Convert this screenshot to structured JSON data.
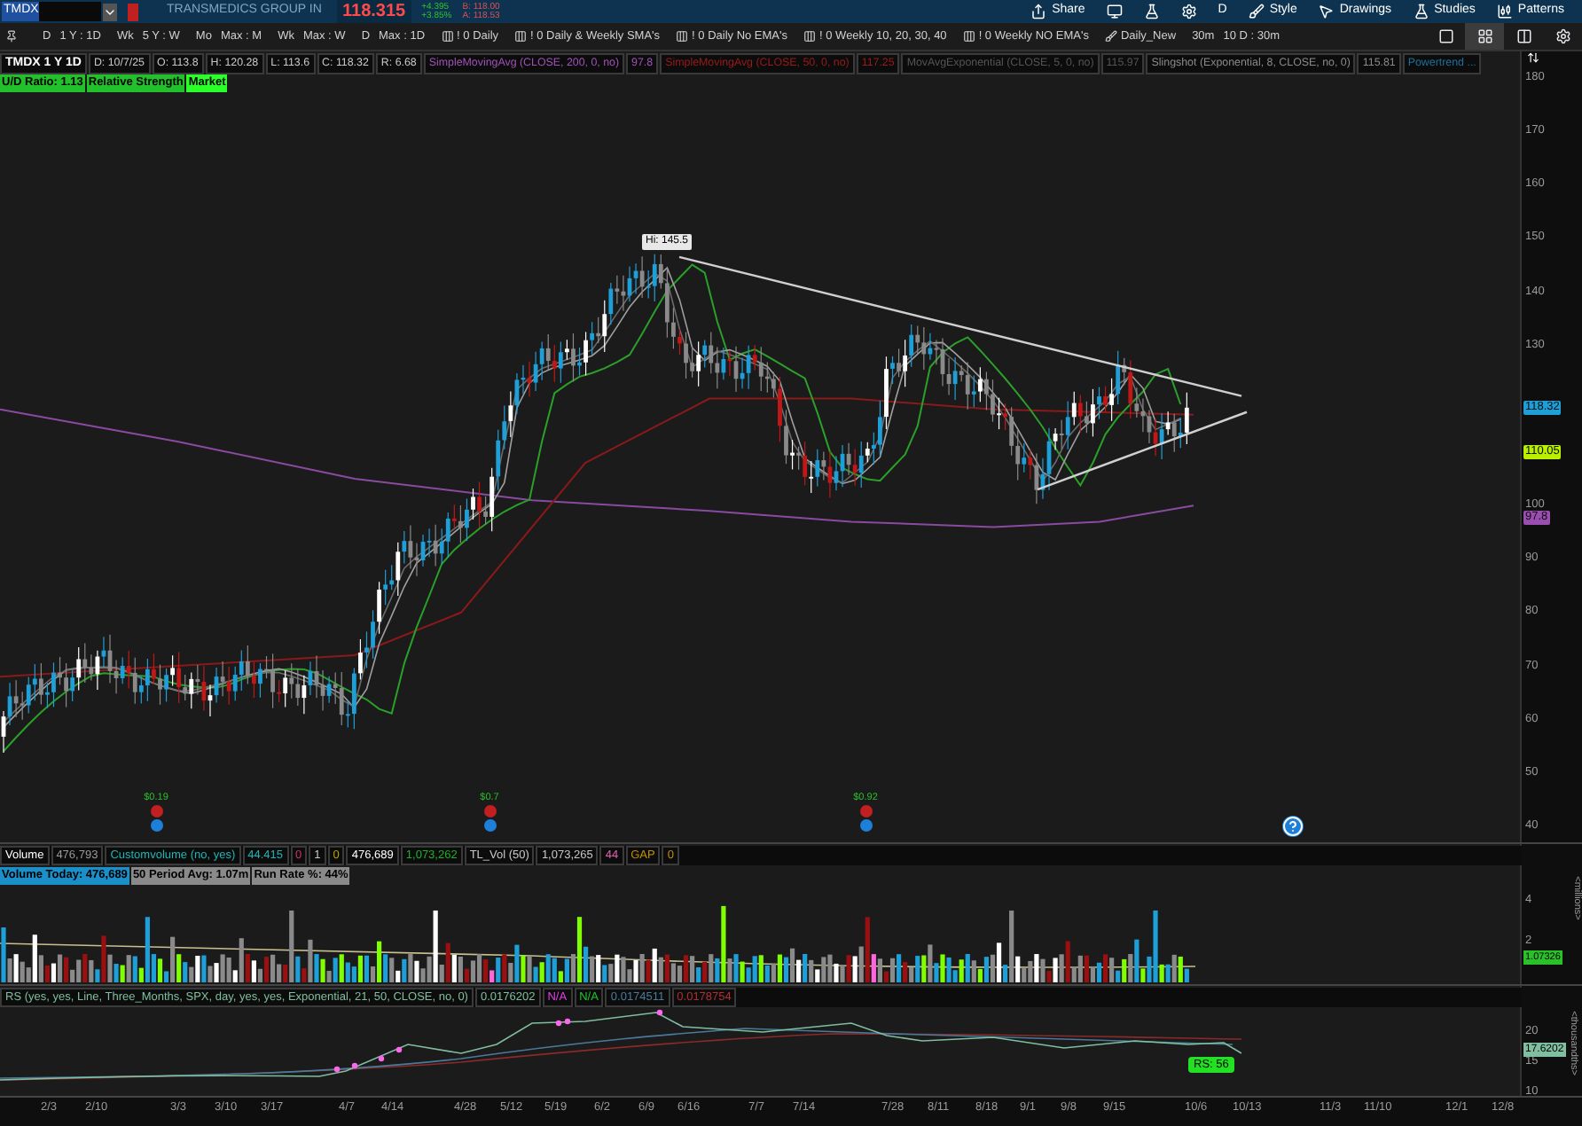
{
  "symbol_bar": {
    "symbol": "TMDX",
    "company": "TRANSMEDICS GROUP IN",
    "last": "118.315",
    "change": "+4.395",
    "change_pct": "+3.85%",
    "bid": "B: 118.00",
    "ask": "A: 118.53",
    "actions": [
      {
        "kind": "share",
        "label": "Share"
      },
      {
        "kind": "screen"
      },
      {
        "kind": "flask"
      },
      {
        "kind": "gear"
      },
      {
        "kind": "text",
        "label": "D"
      },
      {
        "kind": "style",
        "label": "Style"
      },
      {
        "kind": "drawings",
        "label": "Drawings"
      },
      {
        "kind": "studies",
        "label": "Studies"
      },
      {
        "kind": "patterns",
        "label": "Patterns"
      }
    ]
  },
  "toolbar": {
    "items": [
      {
        "kind": "timeframe",
        "prefix": "D",
        "label": "1 Y : 1D"
      },
      {
        "kind": "timeframe",
        "prefix": "Wk",
        "label": "5 Y : W"
      },
      {
        "kind": "timeframe",
        "prefix": "Mo",
        "label": "Max : M"
      },
      {
        "kind": "timeframe",
        "prefix": "Wk",
        "label": "Max : W"
      },
      {
        "kind": "timeframe",
        "prefix": "D",
        "label": "Max : 1D"
      },
      {
        "kind": "preset",
        "label": "! 0 Daily"
      },
      {
        "kind": "preset",
        "label": "! 0 Daily & Weekly SMA's"
      },
      {
        "kind": "preset",
        "label": "! 0 Daily No EMA's"
      },
      {
        "kind": "preset",
        "label": "! 0 Weekly 10, 20, 30, 40"
      },
      {
        "kind": "preset",
        "label": "! 0 Weekly NO EMA's"
      },
      {
        "kind": "style",
        "label": "Daily_New"
      },
      {
        "kind": "timeframe",
        "prefix": "30m",
        "label": "10 D : 30m"
      }
    ],
    "layouts": [
      {
        "kind": "single",
        "selected": false
      },
      {
        "kind": "grid",
        "selected": true
      },
      {
        "kind": "split",
        "selected": false
      },
      {
        "kind": "gear",
        "selected": false
      }
    ]
  },
  "study_header": [
    {
      "text": "TMDX 1 Y 1D",
      "color": "#ffffff"
    },
    {
      "text": "D: 10/7/25",
      "color": "#c8c8c8"
    },
    {
      "text": "O: 113.8",
      "color": "#c8c8c8"
    },
    {
      "text": "H: 120.28",
      "color": "#c8c8c8"
    },
    {
      "text": "L: 113.6",
      "color": "#c8c8c8"
    },
    {
      "text": "C: 118.32",
      "color": "#c8c8c8"
    },
    {
      "text": "R: 6.68",
      "color": "#c8c8c8"
    },
    {
      "text": "SimpleMovingAvg (CLOSE, 200, 0, no)",
      "color": "#a052b8"
    },
    {
      "text": "97.8",
      "color": "#a052b8"
    },
    {
      "text": "SimpleMovingAvg (CLOSE, 50, 0, no)",
      "color": "#9a1c1c"
    },
    {
      "text": "117.25",
      "color": "#9a1c1c"
    },
    {
      "text": "MovAvgExponential (CLOSE, 5, 0, no)",
      "color": "#555555"
    },
    {
      "text": "115.97",
      "color": "#555555"
    },
    {
      "text": "Slingshot (Exponential, 8, CLOSE, no, 0)",
      "color": "#8a8a8a"
    },
    {
      "text": "115.81",
      "color": "#8a8a8a"
    },
    {
      "text": "Powertrend ...",
      "color": "#1f6f9a"
    }
  ],
  "chart_labels": [
    {
      "text": "U/D Ratio: 1.13",
      "color": "#22c02a"
    },
    {
      "text": "Relative Strength",
      "color": "#22c02a"
    },
    {
      "text": "Market",
      "color": "#2aff2a"
    }
  ],
  "price_chart": {
    "high_label": "Hi: 145.5",
    "axis": [
      "180",
      "170",
      "160",
      "150",
      "140",
      "130",
      "100",
      "90",
      "80",
      "70",
      "60",
      "50",
      "40"
    ],
    "markers": [
      {
        "text": "118.32",
        "color": "#1e9fd8"
      },
      {
        "text": "110.05",
        "color": "#b8f000"
      },
      {
        "text": "97.8",
        "color": "#9a4fb0"
      }
    ],
    "dividends": [
      "$0.19",
      "$0.7",
      "$0.92"
    ]
  },
  "volume": {
    "header": [
      {
        "text": "Volume",
        "color": "#ffffff"
      },
      {
        "text": "476,793",
        "color": "#9a9a9a"
      },
      {
        "text": "Customvolume (no, yes)",
        "color": "#1fb5b5"
      },
      {
        "text": "44.415",
        "color": "#1fb5b5"
      },
      {
        "text": "0",
        "color": "#d0306a"
      },
      {
        "text": "1",
        "color": "#c8c8c8"
      },
      {
        "text": "0",
        "color": "#b8a000"
      },
      {
        "text": "476,689",
        "color": "#ffffff"
      },
      {
        "text": "1,073,262",
        "color": "#22b02a"
      },
      {
        "text": "TL_Vol (50)",
        "color": "#c8c8c8"
      },
      {
        "text": "1,073,265",
        "color": "#c8c8c8"
      },
      {
        "text": "44",
        "color": "#e060b0"
      },
      {
        "text": "GAP",
        "color": "#c09000"
      },
      {
        "text": "0",
        "color": "#c09000"
      }
    ],
    "labels": [
      {
        "text": "Volume Today: 476,689",
        "color": "#1a8fc8"
      },
      {
        "text": "50 Period Avg: 1.07m",
        "color": "#8a8a8a"
      },
      {
        "text": "Run Rate %: 44%",
        "color": "#8a8a8a"
      }
    ],
    "axis": [
      "4",
      "2"
    ],
    "marker": "1.07326",
    "unit": "<millions>"
  },
  "rs": {
    "header": [
      {
        "text": "RS (yes, yes, Line, Three_Months, SPX, day, yes, yes, Exponential, 21, 50, CLOSE, no, 0)",
        "color": "#7fbfa0"
      },
      {
        "text": "0.0176202",
        "color": "#7fbfa0"
      },
      {
        "text": "N/A",
        "color": "#e040e0"
      },
      {
        "text": "N/A",
        "color": "#22c02a"
      },
      {
        "text": "0.0174511",
        "color": "#4a7a9a"
      },
      {
        "text": "0.0178754",
        "color": "#b03030"
      }
    ],
    "axis": [
      "20",
      "15",
      "10"
    ],
    "marker": "17.6202",
    "unit": "<thousandths>",
    "badge": "RS: 56"
  },
  "x_axis": [
    "2/3",
    "2/10",
    "3/3",
    "3/10",
    "3/17",
    "4/7",
    "4/14",
    "4/28",
    "5/12",
    "5/19",
    "6/2",
    "6/9",
    "6/16",
    "7/7",
    "7/14",
    "7/28",
    "8/11",
    "8/18",
    "9/1",
    "9/8",
    "9/15",
    "10/6",
    "10/13",
    "11/3",
    "11/10",
    "12/1",
    "12/8"
  ]
}
